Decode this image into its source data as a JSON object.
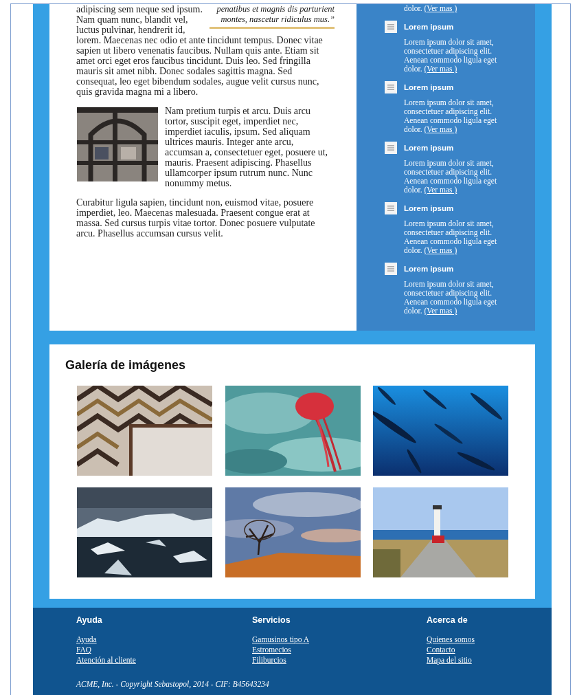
{
  "article": {
    "paragraphs": [
      {
        "text": "adipiscing sem neque sed ipsum. Nam quam nunc, blandit vel, luctus pulvinar, hendrerit id, lorem. Maecenas nec odio et ante tincidunt tempus. Donec vitae sapien ut libero venenatis faucibus. Nullam quis ante. Etiam sit amet orci eget eros faucibus tincidunt. Duis leo. Sed fringilla mauris sit amet nibh. Donec sodales sagittis magna. Sed consequat, leo eget bibendum sodales, augue velit cursus nunc, quis gravida magna mi a libero.",
        "quote": "penatibus et magnis dis parturient montes, nascetur ridiculus mus.”"
      },
      {
        "text": "Nam pretium turpis et arcu. Duis arcu tortor, suscipit eget, imperdiet nec, imperdiet iaculis, ipsum. Sed aliquam ultrices mauris. Integer ante arcu, accumsan a, consectetuer eget, posuere ut, mauris. Praesent adipiscing. Phasellus ullamcorper ipsum rutrum nunc. Nunc nonummy metus."
      },
      {
        "text": "Curabitur ligula sapien, tincidunt non, euismod vitae, posuere imperdiet, leo. Maecenas malesuada. Praesent congue erat at massa. Sed cursus turpis vitae tortor. Donec posuere vulputate arcu. Phasellus accumsan cursus velit."
      }
    ]
  },
  "sidebar": {
    "cut_text": "dolor.",
    "cut_link": "(Ver mas )",
    "items": [
      {
        "title": "Lorem ipsum",
        "text": "Lorem ipsum dolor sit amet, consectetuer adipiscing elit. Aenean commodo ligula eget dolor.",
        "link": "(Ver mas )"
      },
      {
        "title": "Lorem ipsum",
        "text": "Lorem ipsum dolor sit amet, consectetuer adipiscing elit. Aenean commodo ligula eget dolor.",
        "link": "(Ver mas )"
      },
      {
        "title": "Lorem ipsum",
        "text": "Lorem ipsum dolor sit amet, consectetuer adipiscing elit. Aenean commodo ligula eget dolor.",
        "link": "(Ver mas )"
      },
      {
        "title": "Lorem ipsum",
        "text": "Lorem ipsum dolor sit amet, consectetuer adipiscing elit. Aenean commodo ligula eget dolor.",
        "link": "(Ver mas )"
      },
      {
        "title": "Lorem ipsum",
        "text": "Lorem ipsum dolor sit amet, consectetuer adipiscing elit. Aenean commodo ligula eget dolor.",
        "link": "(Ver mas )"
      }
    ]
  },
  "gallery": {
    "title": "Galería de imágenes"
  },
  "footer": {
    "columns": [
      {
        "title": "Ayuda",
        "links": [
          "Ayuda",
          "FAQ",
          "Atención al cliente"
        ]
      },
      {
        "title": "Servicios",
        "links": [
          "Gamusinos tipo A",
          "Estromecios",
          "Filiburcios"
        ]
      },
      {
        "title": "Acerca de",
        "links": [
          "Quienes somos",
          "Contacto",
          "Mapa del sitio"
        ]
      }
    ],
    "copyright": "ACME, Inc. - Copyright Sebastopol, 2014 - CIF: B45643234"
  }
}
